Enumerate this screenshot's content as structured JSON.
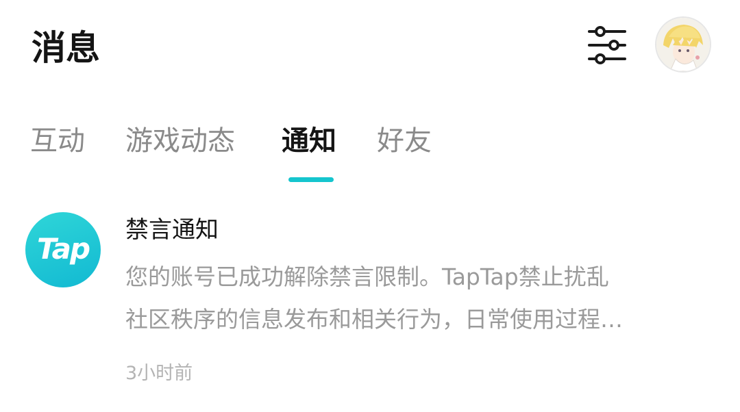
{
  "header": {
    "title": "消息",
    "filter_icon": "sliders-icon",
    "avatar_icon": "user-avatar"
  },
  "tabs": [
    {
      "label": "互动",
      "active": false
    },
    {
      "label": "游戏动态",
      "active": false
    },
    {
      "label": "通知",
      "active": true
    },
    {
      "label": "好友",
      "active": false
    }
  ],
  "accent_color": "#15c5ce",
  "notification": {
    "logo_text": "Tap",
    "title": "禁言通知",
    "body_line1": "您的账号已成功解除禁言限制。TapTap禁止扰乱",
    "body_line2": "社区秩序的信息发布和相关行为，日常使用过程…",
    "time": "3小时前"
  }
}
